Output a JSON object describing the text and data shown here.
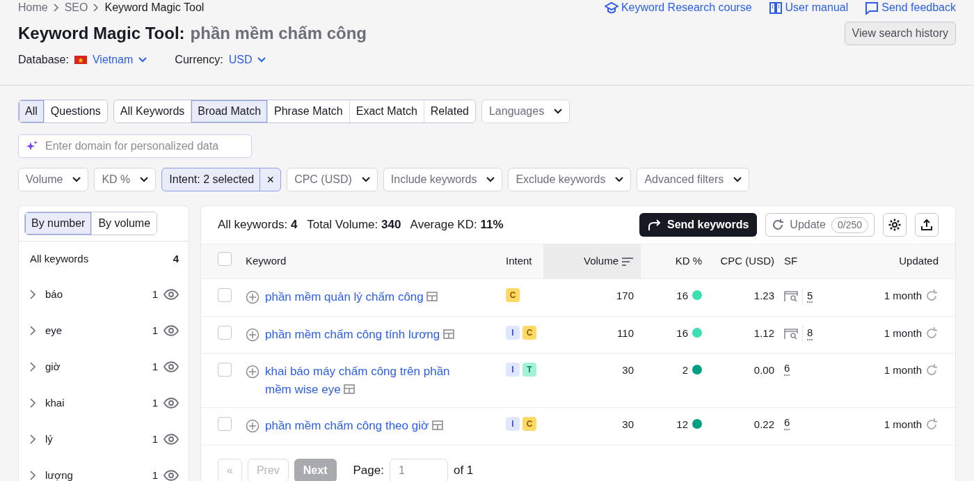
{
  "breadcrumbs": [
    "Home",
    "SEO",
    "Keyword Magic Tool"
  ],
  "header_links": [
    {
      "kind": "course",
      "label": "Keyword Research course"
    },
    {
      "kind": "manual",
      "label": "User manual"
    },
    {
      "kind": "feedback",
      "label": "Send feedback"
    }
  ],
  "title": "Keyword Magic Tool:",
  "query": "phần mềm chấm công",
  "history_button": "View search history",
  "database": {
    "label": "Database:",
    "value": "Vietnam"
  },
  "currency": {
    "label": "Currency:",
    "value": "USD"
  },
  "question_tabs": [
    {
      "label": "All",
      "selected": true
    },
    {
      "label": "Questions",
      "selected": false
    }
  ],
  "match_tabs": [
    {
      "label": "All Keywords",
      "selected": false
    },
    {
      "label": "Broad Match",
      "selected": true
    },
    {
      "label": "Phrase Match",
      "selected": false
    },
    {
      "label": "Exact Match",
      "selected": false
    },
    {
      "label": "Related",
      "selected": false
    }
  ],
  "languages": "Languages",
  "domain_field": {
    "placeholder": "Enter domain for personalized data"
  },
  "filters": [
    {
      "label": "Volume",
      "active": false
    },
    {
      "label": "KD %",
      "active": false
    },
    {
      "label": "Intent: 2 selected",
      "active": true,
      "clear": "×"
    },
    {
      "label": "CPC (USD)",
      "active": false
    },
    {
      "label": "Include keywords",
      "active": false
    },
    {
      "label": "Exclude keywords",
      "active": false
    },
    {
      "label": "Advanced filters",
      "active": false
    }
  ],
  "sidebar": {
    "tabs": [
      {
        "label": "By number",
        "selected": true
      },
      {
        "label": "By volume",
        "selected": false
      }
    ],
    "all": {
      "label": "All keywords",
      "count": "4"
    },
    "items": [
      {
        "label": "báo",
        "count": "1"
      },
      {
        "label": "eye",
        "count": "1"
      },
      {
        "label": "giờ",
        "count": "1"
      },
      {
        "label": "khai",
        "count": "1"
      },
      {
        "label": "lý",
        "count": "1"
      },
      {
        "label": "lượng",
        "count": "1"
      }
    ]
  },
  "summary": "All keywords: **4**   Total Volume: **340**   Average KD: **11%**",
  "send_button": "Send keywords",
  "update_button": "Update",
  "update_count": "0/250",
  "table": {
    "header_checked": false,
    "columns": [
      {
        "label": "Keyword",
        "sorted": false
      },
      {
        "label": "Intent",
        "sorted": false
      },
      {
        "label": "Volume",
        "sorted": true
      },
      {
        "label": "KD %",
        "sorted": false
      },
      {
        "label": "CPC (USD)",
        "sorted": false
      },
      {
        "label": "SF",
        "sorted": false
      },
      {
        "label": "Updated",
        "sorted": false
      }
    ],
    "rows": [
      {
        "checked": false,
        "keyword": "phần mềm quản lý chấm công",
        "intents": [
          {
            "kind": "commercial",
            "label": "C"
          }
        ],
        "volume": "170",
        "kd": "16",
        "color": "#3be0b0",
        "cpc": "1.23",
        "sf_icon": true,
        "sf": "5",
        "updated": "1 month"
      },
      {
        "checked": false,
        "keyword": "phần mềm chấm công tính lương",
        "intents": [
          {
            "kind": "informational",
            "label": "I"
          },
          {
            "kind": "commercial",
            "label": "C"
          }
        ],
        "volume": "110",
        "kd": "16",
        "color": "#3be0b0",
        "cpc": "1.12",
        "sf_icon": true,
        "sf": "8",
        "updated": "1 month"
      },
      {
        "checked": false,
        "keyword": "khai báo máy chấm công trên phần mềm wise eye",
        "intents": [
          {
            "kind": "informational",
            "label": "I"
          },
          {
            "kind": "transactional",
            "label": "T"
          }
        ],
        "volume": "30",
        "kd": "2",
        "color": "#009f81",
        "cpc": "0.00",
        "sf_icon": false,
        "sf": "6",
        "updated": "1 month"
      },
      {
        "checked": false,
        "keyword": "phần mềm chấm công theo giờ",
        "intents": [
          {
            "kind": "informational",
            "label": "I"
          },
          {
            "kind": "commercial",
            "label": "C"
          }
        ],
        "volume": "30",
        "kd": "12",
        "color": "#009f81",
        "cpc": "0.22",
        "sf_icon": false,
        "sf": "6",
        "updated": "1 month"
      }
    ]
  },
  "pagination": {
    "first": "«",
    "prev": "Prev",
    "prev_disabled": true,
    "next": "Next",
    "next_disabled": true,
    "page_label": "Page:",
    "page": "1",
    "of": "of 1"
  }
}
